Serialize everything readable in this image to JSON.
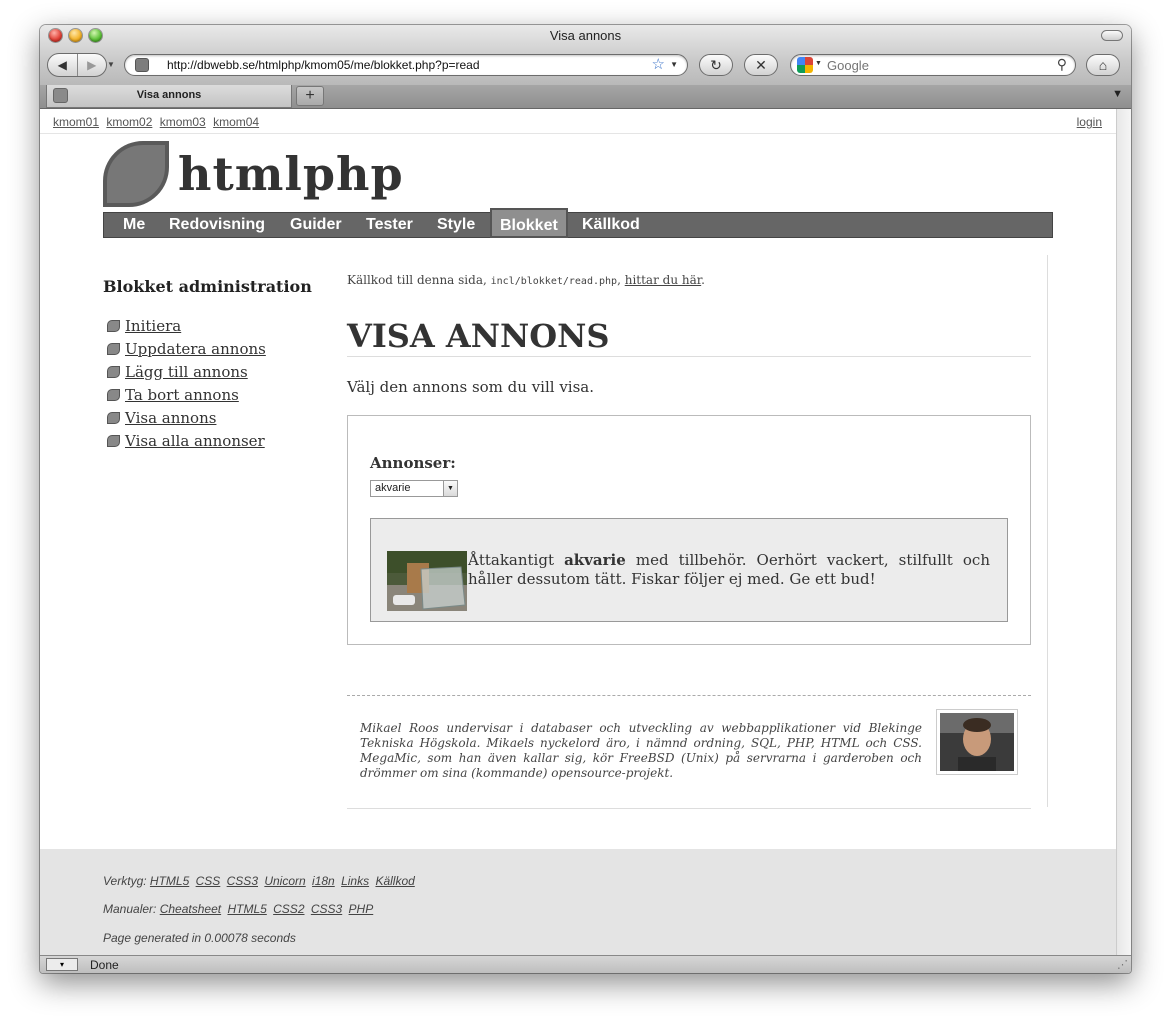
{
  "browser": {
    "window_title": "Visa annons",
    "url": "http://dbwebb.se/htmlphp/kmom05/me/blokket.php?p=read",
    "search_placeholder": "Google",
    "tab_label": "Visa annons",
    "new_tab": "+",
    "status": "Done"
  },
  "topnav": {
    "links": [
      "kmom01",
      "kmom02",
      "kmom03",
      "kmom04"
    ],
    "login": "login"
  },
  "site": {
    "title": "htmlphp"
  },
  "mainnav": {
    "items": [
      "Me",
      "Redovisning",
      "Guider",
      "Tester",
      "Style",
      "Blokket",
      "Källkod"
    ],
    "active": "Blokket"
  },
  "sidebar": {
    "title": "Blokket administration",
    "items": [
      "Initiera",
      "Uppdatera annons",
      "Lägg till annons",
      "Ta bort annons",
      "Visa annons",
      "Visa alla annonser"
    ]
  },
  "main": {
    "source_prefix": "Källkod till denna sida,",
    "source_path": "incl/blokket/read.php",
    "source_sep": ",",
    "source_link": "hittar du här",
    "source_end": ".",
    "heading": "VISA ANNONS",
    "intro": "Välj den annons som du vill visa.",
    "form_label": "Annonser:",
    "select_value": "akvarie",
    "ad": {
      "text_before": "Åttakantigt",
      "text_bold": "akvarie",
      "text_after": "med tillbehör. Oerhört vackert, stilfullt och håller dessutom tätt. Fiskar följer ej med. Ge ett bud!"
    }
  },
  "bio": {
    "text": "Mikael Roos undervisar i databaser och utveckling av webbapplikationer vid Blekinge Tekniska Högskola. Mikaels nyckelord äro, i nämnd ordning, SQL, PHP, HTML och CSS. MegaMic, som han även kallar sig, kör FreeBSD (Unix) på servrarna i garderoben och drömmer om sina (kommande) opensource-projekt."
  },
  "footer": {
    "tools_label": "Verktyg:",
    "tools": [
      "HTML5",
      "CSS",
      "CSS3",
      "Unicorn",
      "i18n",
      "Links",
      "Källkod"
    ],
    "manuals_label": "Manualer:",
    "manuals": [
      "Cheatsheet",
      "HTML5",
      "CSS2",
      "CSS3",
      "PHP"
    ],
    "generated": "Page generated in 0.00078 seconds"
  }
}
